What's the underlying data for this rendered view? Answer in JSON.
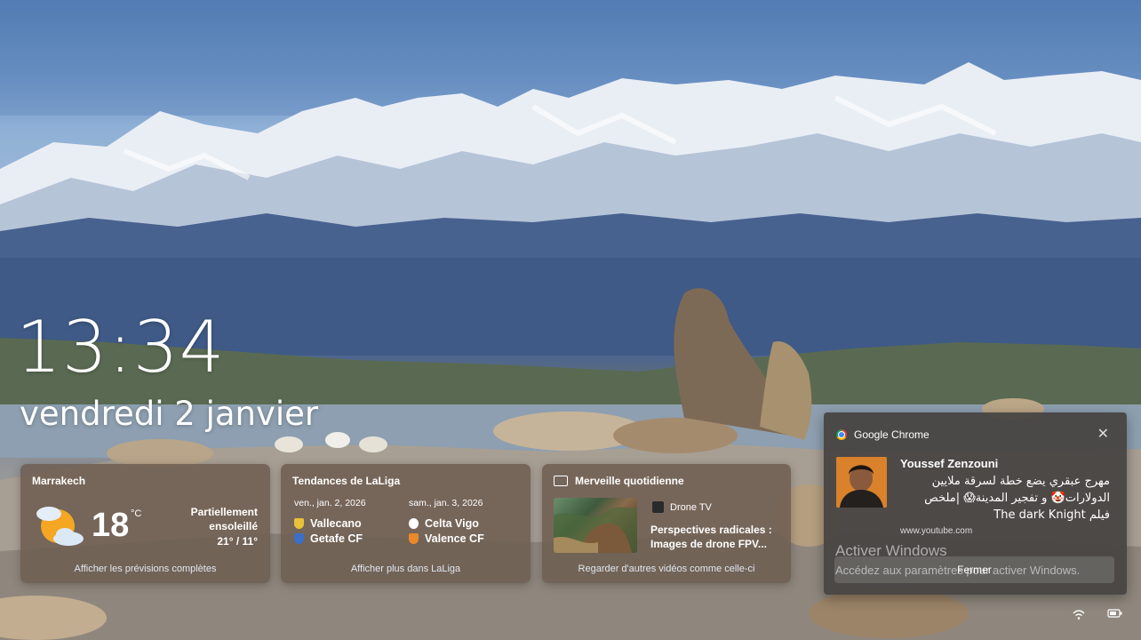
{
  "lockscreen": {
    "time": "13:34",
    "date": "vendredi 2 janvier"
  },
  "widgets": {
    "weather": {
      "location": "Marrakech",
      "temperature": "18",
      "unit": "°C",
      "condition": "Partiellement ensoleillé",
      "range": "21° / 11°",
      "footer": "Afficher les prévisions complètes",
      "icon": "partly-sunny-icon"
    },
    "laliga": {
      "title": "Tendances de LaLiga",
      "match1": {
        "date": "ven., jan. 2, 2026",
        "home": "Vallecano",
        "away": "Getafe CF"
      },
      "match2": {
        "date": "sam., jan. 3, 2026",
        "home": "Celta Vigo",
        "away": "Valence CF"
      },
      "footer": "Afficher plus dans LaLiga"
    },
    "daily": {
      "title": "Merveille quotidienne",
      "source": "Drone TV",
      "headline": "Perspectives radicales : Images de drone FPV...",
      "footer": "Regarder d'autres vidéos comme celle-ci"
    }
  },
  "notification": {
    "app": "Google Chrome",
    "sender": "Youssef Zenzouni",
    "message": "مهرج عبقري يضع خطة لسرقة ملايين الدولارات🤡 و تفجير المدينة😱 |ملخص فيلم The dark Knight",
    "url": "www.youtube.com",
    "button": "Fermer",
    "close_icon": "close-icon"
  },
  "watermark": {
    "title": "Activer Windows",
    "subtitle": "Accédez aux paramètres pour activer Windows."
  },
  "tray": {
    "icons": [
      "wifi-icon",
      "battery-icon"
    ]
  }
}
